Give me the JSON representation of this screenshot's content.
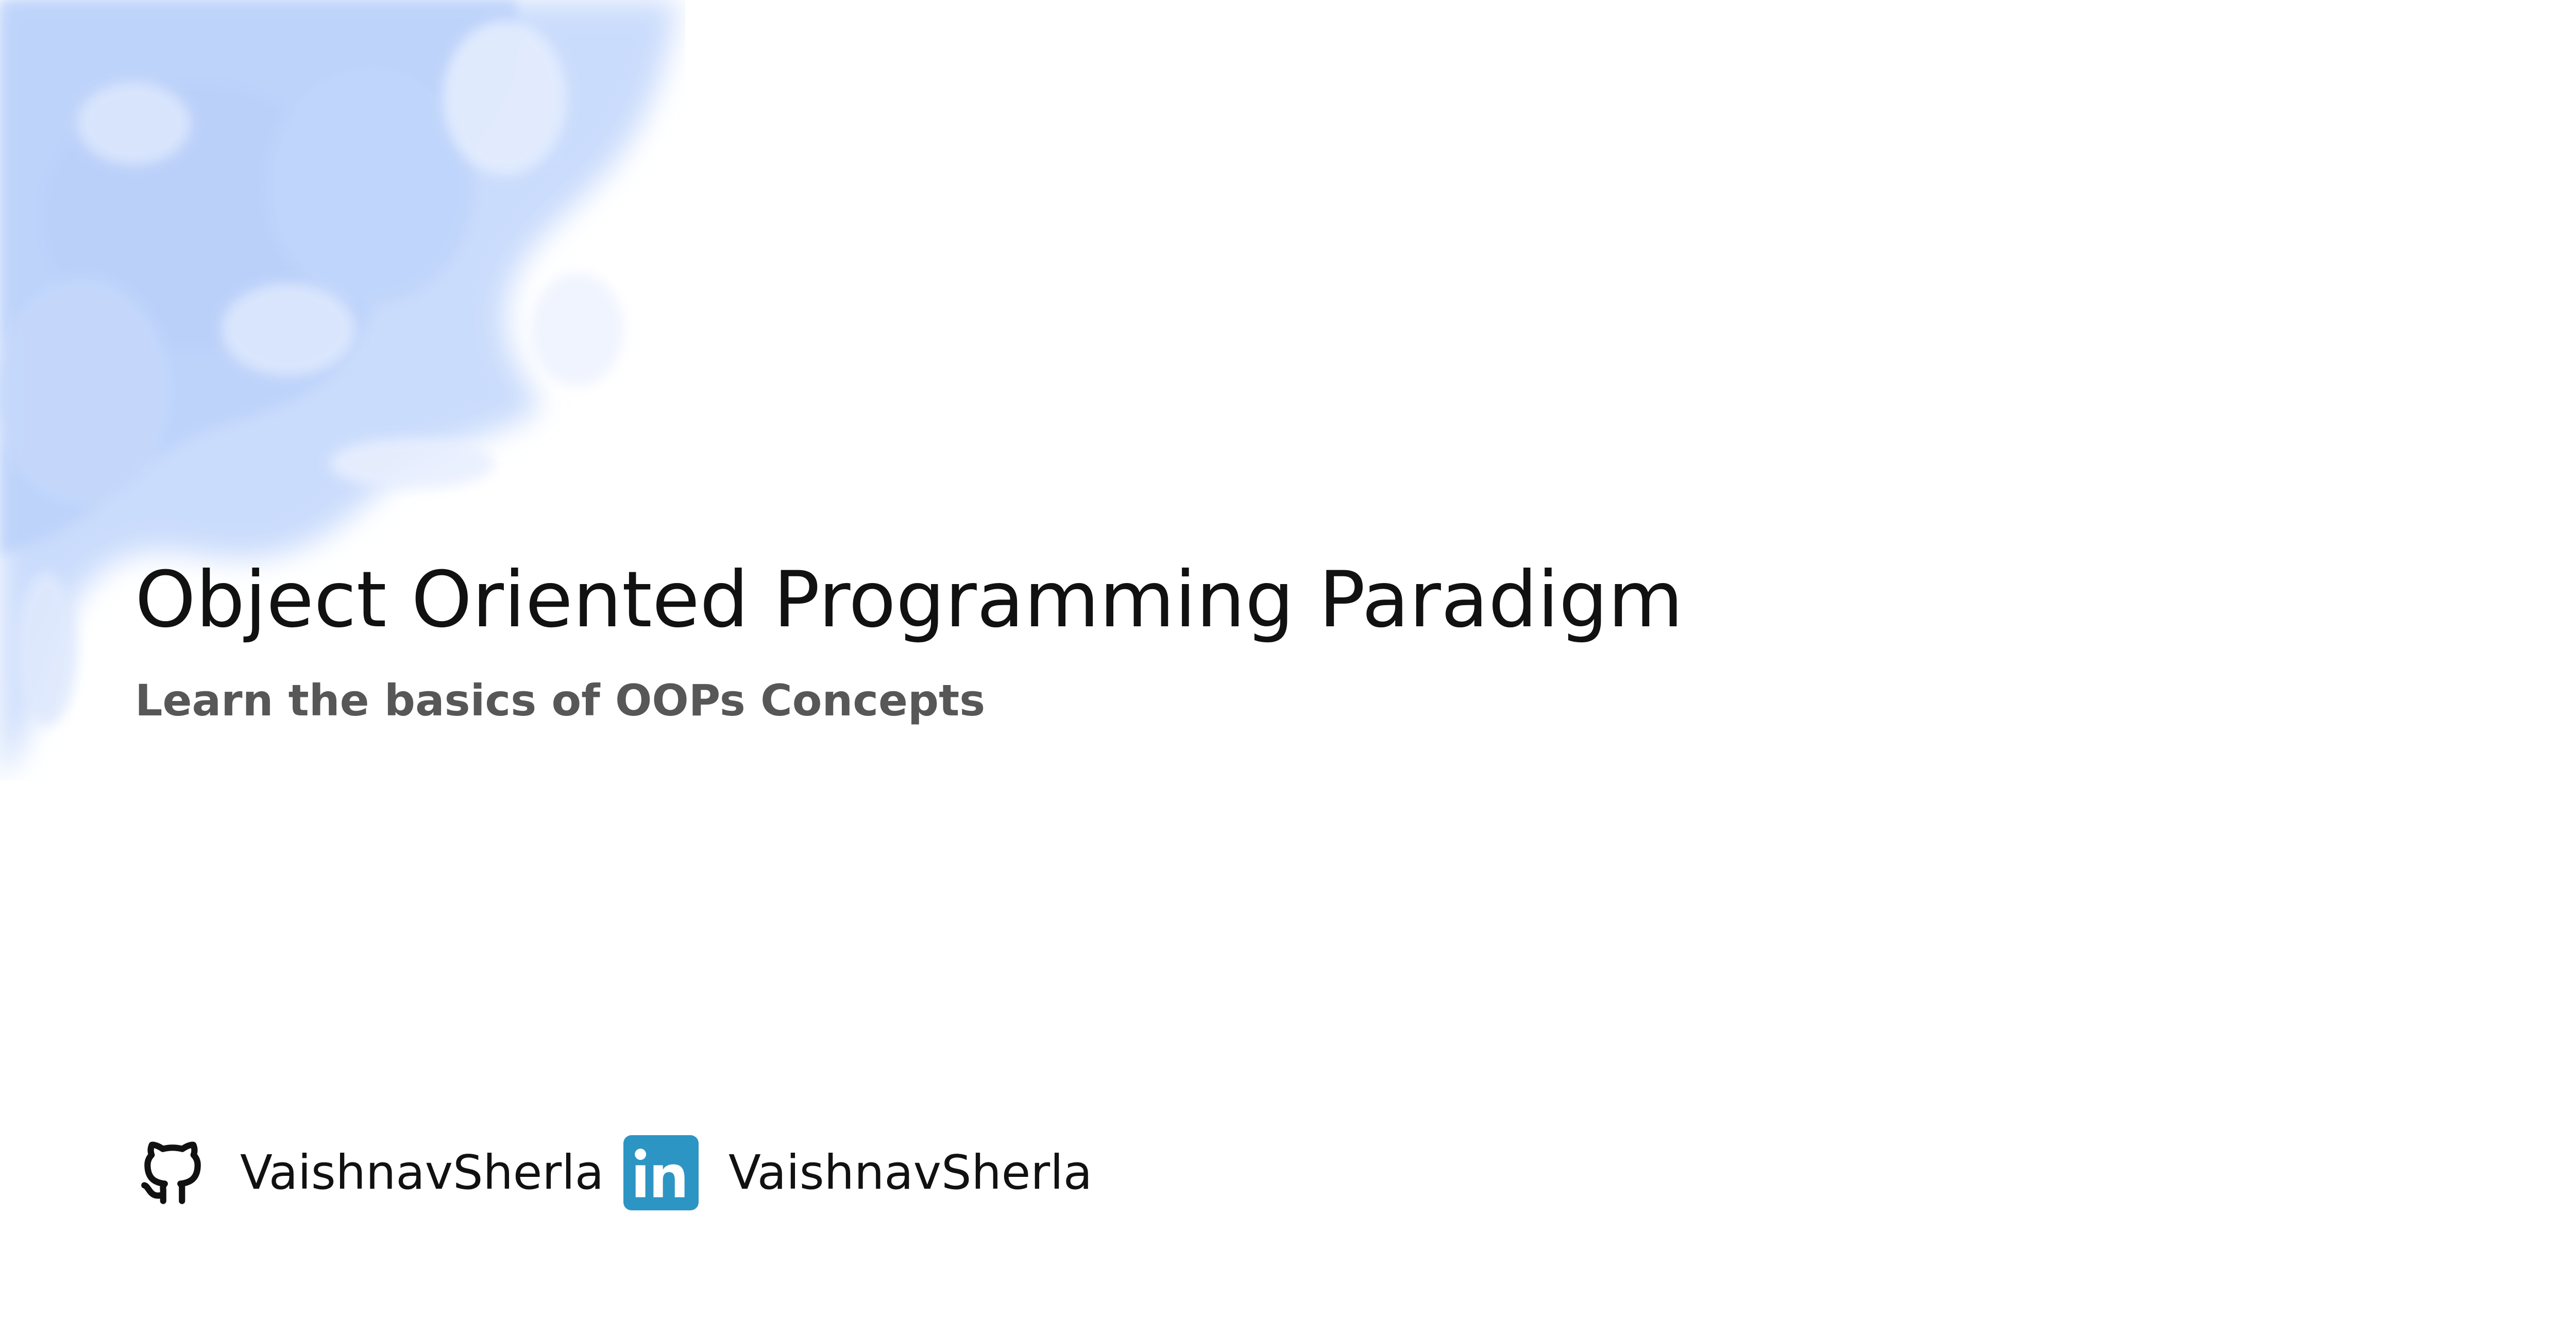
{
  "header": {
    "title": "Object Oriented Programming Paradigm",
    "subtitle": "Learn the basics of OOPs Concepts"
  },
  "social": [
    {
      "icon": "github-icon",
      "label": "VaishnavSherla"
    },
    {
      "icon": "linkedin-icon",
      "label": "VaishnavSherla"
    }
  ],
  "colors": {
    "background": "#ffffff",
    "title": "#111111",
    "subtitle": "#575757",
    "smoke": "#c9dcfc",
    "linkedin": "#2d95c3"
  }
}
